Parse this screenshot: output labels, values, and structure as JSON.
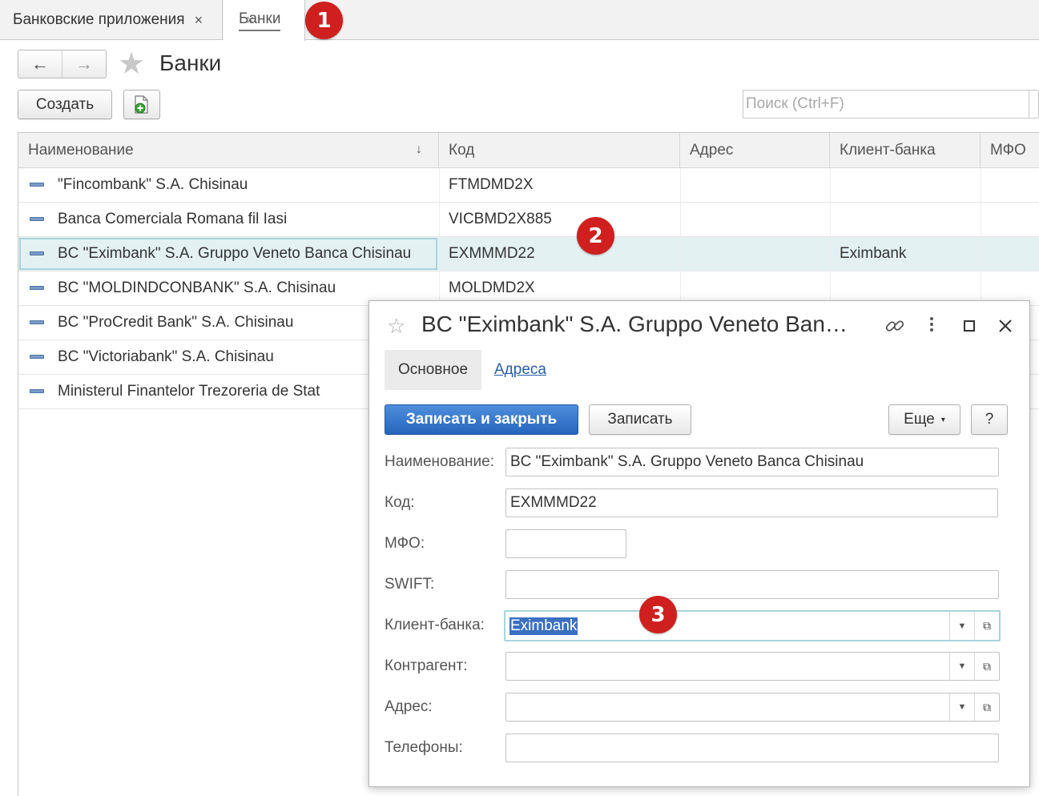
{
  "tabs": [
    {
      "label": "Банковские приложения",
      "close": "×"
    },
    {
      "label": "Банки",
      "close": "×"
    }
  ],
  "badges": [
    "1",
    "2",
    "3"
  ],
  "header": {
    "title": "Банки",
    "back": "←",
    "forward": "→"
  },
  "toolbar": {
    "create_label": "Создать",
    "search_placeholder": "Поиск (Ctrl+F)"
  },
  "table": {
    "columns": [
      "Наименование",
      "Код",
      "Адрес",
      "Клиент-банка",
      "МФО"
    ],
    "sort_indicator": "↓",
    "rows": [
      {
        "name": "\"Fincombank\" S.A. Chisinau",
        "code": "FTMDMD2X",
        "address": "",
        "client_bank": "",
        "mfo": ""
      },
      {
        "name": "Banca Comerciala Romana fil Iasi",
        "code": "VICBMD2X885",
        "address": "",
        "client_bank": "",
        "mfo": ""
      },
      {
        "name": "BC \"Eximbank\" S.A. Gruppo Veneto Banca Chisinau",
        "code": "EXMMMD22",
        "address": "",
        "client_bank": "Eximbank",
        "mfo": ""
      },
      {
        "name": "BC \"MOLDINDCONBANK\" S.A. Chisinau",
        "code": "MOLDMD2X",
        "address": "",
        "client_bank": "",
        "mfo": ""
      },
      {
        "name": "BC \"ProCredit Bank\" S.A. Chisinau",
        "code": "",
        "address": "",
        "client_bank": "",
        "mfo": ""
      },
      {
        "name": "BC \"Victoriabank\" S.A. Chisinau",
        "code": "",
        "address": "",
        "client_bank": "",
        "mfo": ""
      },
      {
        "name": "Ministerul Finantelor Trezoreria de Stat",
        "code": "",
        "address": "",
        "client_bank": "",
        "mfo": ""
      }
    ]
  },
  "dialog": {
    "title": "BC \"Eximbank\" S.A. Gruppo Veneto Ban…",
    "tabs": [
      "Основное",
      "Адреса"
    ],
    "buttons": {
      "save_close": "Записать и закрыть",
      "save": "Записать",
      "more": "Еще",
      "help": "?"
    },
    "fields": {
      "name": {
        "label": "Наименование:",
        "value": "BC \"Eximbank\" S.A. Gruppo Veneto Banca Chisinau"
      },
      "code": {
        "label": "Код:",
        "value": "EXMMMD22"
      },
      "mfo": {
        "label": "МФО:",
        "value": ""
      },
      "swift": {
        "label": "SWIFT:",
        "value": ""
      },
      "client_bank": {
        "label": "Клиент-банка:",
        "value": "Eximbank"
      },
      "counterparty": {
        "label": "Контрагент:",
        "value": ""
      },
      "address": {
        "label": "Адрес:",
        "value": ""
      },
      "phones": {
        "label": "Телефоны:",
        "value": ""
      }
    }
  },
  "colors": {
    "badge": "#cf1f1f",
    "primary": "#2665bd",
    "selection": "#e3f1f3",
    "link": "#2a5ea8"
  }
}
